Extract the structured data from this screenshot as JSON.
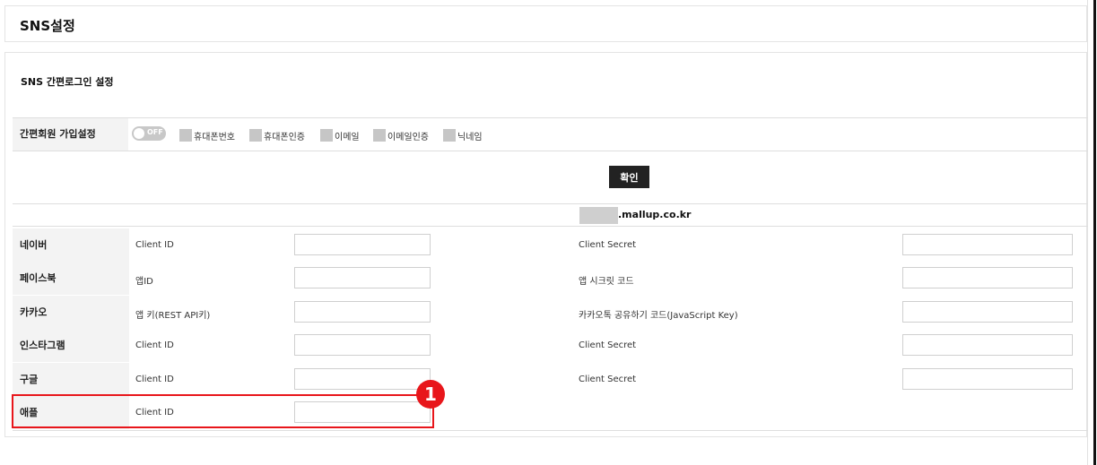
{
  "page_title": "SNS설정",
  "section_title": "SNS 간편로그인 설정",
  "signup": {
    "label": "간편회원 가입설정",
    "toggle_text": "OFF",
    "options": [
      "휴대폰번호",
      "휴대폰인증",
      "이메일",
      "이메일인증",
      "닉네임"
    ]
  },
  "confirm_label": "확인",
  "domain": ".mallup.co.kr",
  "providers": [
    {
      "name": "네이버",
      "label1": "Client ID",
      "label2": "Client Secret",
      "value1": "",
      "value2": ""
    },
    {
      "name": "페이스북",
      "label1": "앱ID",
      "label2": "앱 시크릿 코드",
      "value1": "",
      "value2": ""
    },
    {
      "name": "카카오",
      "label1": "앱 키(REST API키)",
      "label2": "카카오톡 공유하기 코드(JavaScript Key)",
      "value1": "",
      "value2": ""
    },
    {
      "name": "인스타그램",
      "label1": "Client ID",
      "label2": "Client Secret",
      "value1": "",
      "value2": ""
    },
    {
      "name": "구글",
      "label1": "Client ID",
      "label2": "Client Secret",
      "value1": "",
      "value2": ""
    },
    {
      "name": "애플",
      "label1": "Client ID",
      "value1": ""
    }
  ],
  "annotation_marker": "1",
  "colors": {
    "highlight": "#e8161b",
    "button_bg": "#222222",
    "label_bg": "#f3f3f3"
  }
}
